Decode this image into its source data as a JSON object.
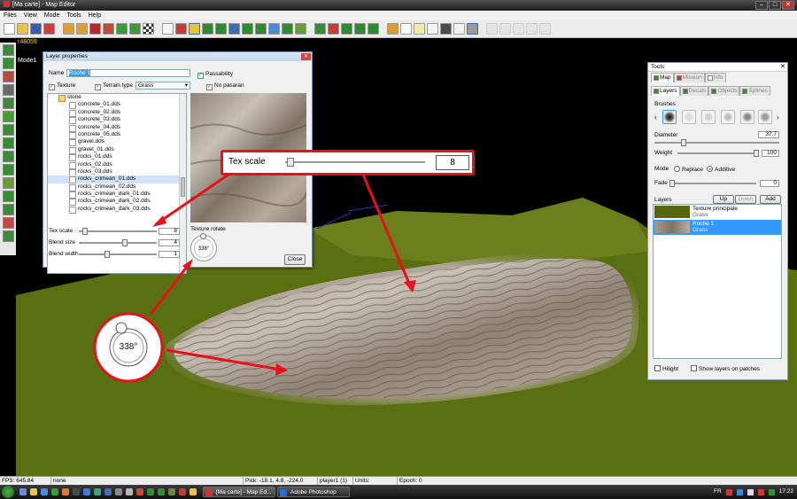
{
  "window": {
    "title": "[Ma carte] - Map Editor"
  },
  "menu": [
    "Files",
    "View",
    "Mode",
    "Tools",
    "Help"
  ],
  "hud": {
    "version": "r48059",
    "mode": "Mode1"
  },
  "layer_properties": {
    "title": "Layer properties",
    "name_label": "Name",
    "name_value": "Roche 1",
    "passability_label": "Passability",
    "no_pasaran_label": "No pasaran",
    "texture_label": "Texture",
    "terrain_type_label": "Terrain type",
    "terrain_type_value": "Grass",
    "tree": {
      "folder": "stone",
      "items": [
        "concrete_01.dds",
        "concrete_02.dds",
        "concrete_03.dds",
        "concrete_04.dds",
        "concrete_05.dds",
        "gravel.dds",
        "gravel_01.dds",
        "rocks_01.dds",
        "rocks_02.dds",
        "rocks_03.dds",
        "rocks_crimean_01.dds",
        "rocks_crimean_02.dds",
        "rocks_crimean_dark_01.dds",
        "rocks_crimean_dark_02.dds",
        "rocks_crimean_dark_03.dds"
      ],
      "selected_index": 10
    },
    "tex_scale_label": "Tex scale",
    "tex_scale_value": "8",
    "blend_size_label": "Blend size",
    "blend_size_value": "4",
    "blend_width_label": "Blend width",
    "blend_width_value": "1",
    "texture_rotate_label": "Texture rotate",
    "rotate_value": "338°",
    "close_label": "Close",
    "sliders": {
      "tex_scale": 0.05,
      "blend_size": 0.6,
      "blend_width": 0.35
    }
  },
  "callout": {
    "label": "Tex scale",
    "value": "8",
    "slider": 0.01
  },
  "zoom_dial": {
    "value": "338°"
  },
  "tools": {
    "title": "Tools",
    "tabs": [
      "Map",
      "Mission",
      "Info"
    ],
    "subtabs": [
      "Layers",
      "Decals",
      "Objects",
      "Splines"
    ],
    "brushes_label": "Brushes",
    "diameter_label": "Diameter",
    "diameter_value": "37.7",
    "diameter_level": 0.22,
    "weight_label": "Weight",
    "weight_value": "100",
    "weight_level": 1.0,
    "mode_label": "Mode",
    "mode_replace": "Replace",
    "mode_additive": "Additive",
    "fade_label": "Fade",
    "fade_value": "0",
    "fade_level": 0.0,
    "layers_label": "Layers",
    "up_label": "Up",
    "down_label": "Down",
    "add_label": "Add",
    "layers": [
      {
        "title": "Texture principale",
        "sub": "Grass"
      },
      {
        "title": "Roche 1",
        "sub": "Grass"
      }
    ],
    "hilight_label": "Hilight",
    "show_layers_label": "Show layers on patches"
  },
  "status": {
    "fps": "FPS: 645.84",
    "sel": "none",
    "pick": "Pick: -18.1, 4.8, -224.0",
    "player": "player1 (1)",
    "units": "Units:",
    "epoch": "Epoch: 0"
  },
  "taskbar": {
    "tasks": [
      "[Ma carte] - Map Ed...",
      "Adobe Photoshop"
    ],
    "lang": "FR",
    "time": "17:22"
  },
  "colors": {
    "accent_red": "#e8101a",
    "selection_blue": "#3399ff",
    "grass": "#5a6e12"
  }
}
